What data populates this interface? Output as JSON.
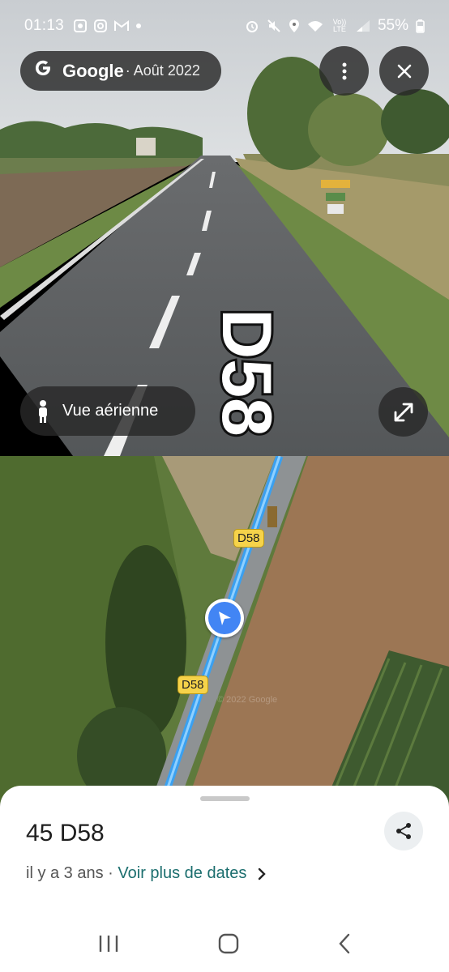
{
  "status_bar": {
    "time": "01:13",
    "network_label": "Vo)) LTE",
    "battery_percent": "55%"
  },
  "street_view": {
    "brand": "Google",
    "capture_date": "· Août 2022",
    "road_label": "D58",
    "aerial_toggle_label": "Vue aérienne"
  },
  "map": {
    "road_shields": [
      "D58",
      "D58"
    ],
    "watermark": "© 2022 Google",
    "colors": {
      "route": "#3aa0f0",
      "shield": "#f6d34a",
      "marker": "#4285f4"
    }
  },
  "sheet": {
    "title": "45 D58",
    "age": "il y a 3 ans",
    "separator": " · ",
    "more_dates_link": "Voir plus de dates"
  },
  "colors": {
    "link": "#1b6e6e",
    "overlay": "#282828"
  },
  "icons": [
    "photos-app-icon",
    "instagram-icon",
    "gmail-icon",
    "alarm-icon",
    "mute-icon",
    "location-icon",
    "wifi-icon",
    "signal-icon",
    "battery-icon",
    "more-vert-icon",
    "close-icon",
    "pegman-icon",
    "expand-icon",
    "navigation-arrow-icon",
    "share-icon",
    "chevron-right-icon",
    "recents-icon",
    "home-icon",
    "back-icon"
  ]
}
